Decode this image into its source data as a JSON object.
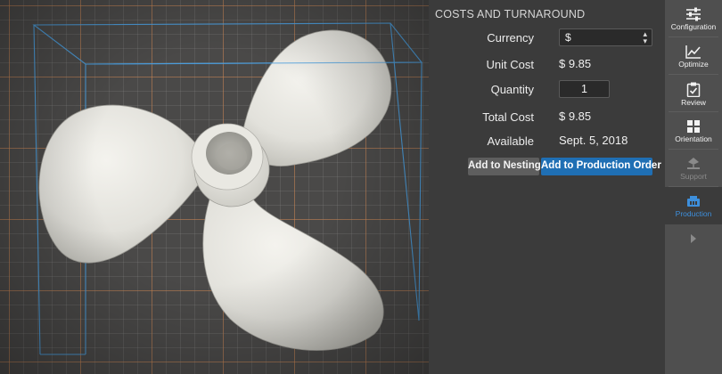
{
  "panel": {
    "title": "COSTS AND TURNAROUND",
    "currency_label": "Currency",
    "currency_value": "$",
    "unit_cost_label": "Unit Cost",
    "unit_cost_value": "$ 9.85",
    "quantity_label": "Quantity",
    "quantity_value": "1",
    "total_cost_label": "Total Cost",
    "total_cost_value": "$ 9.85",
    "available_label": "Available",
    "available_value": "Sept. 5, 2018",
    "add_to_nesting": "Add to Nesting",
    "add_to_production_order": "Add to Production Order"
  },
  "toolbar": {
    "items": [
      {
        "label": "Configuration",
        "icon": "sliders-icon",
        "state": "normal"
      },
      {
        "label": "Optimize",
        "icon": "line-chart-icon",
        "state": "normal"
      },
      {
        "label": "Review",
        "icon": "clipboard-check-icon",
        "state": "normal"
      },
      {
        "label": "Orientation",
        "icon": "orientation-arrows-icon",
        "state": "normal"
      },
      {
        "label": "Support",
        "icon": "support-icon",
        "state": "disabled"
      },
      {
        "label": "Production",
        "icon": "factory-icon",
        "state": "active"
      }
    ],
    "expand_icon": "chevron-right-icon"
  },
  "colors": {
    "accent": "#1f6fb4",
    "active_tab_text": "#3d8fdc",
    "panel_bg": "#3b3b3b",
    "toolbar_bg": "#4f4f4f",
    "bounding_box": "#4a9fe0",
    "grid_major": "#d68246"
  }
}
